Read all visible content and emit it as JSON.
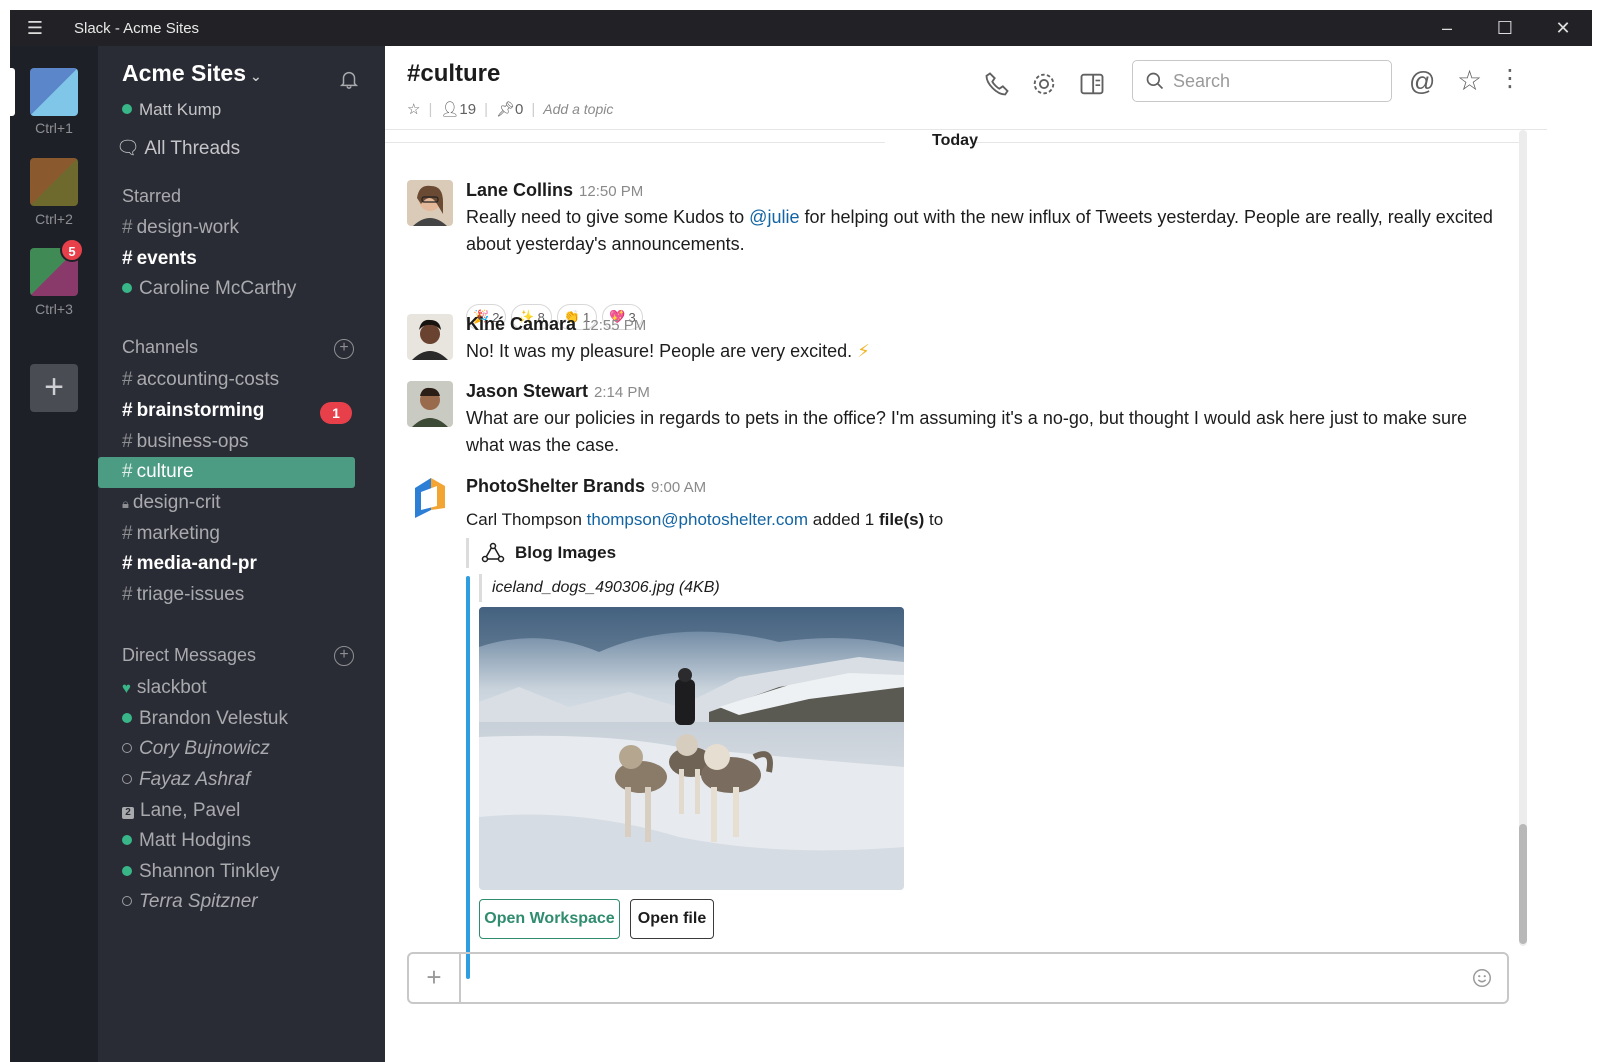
{
  "window": {
    "title": "Slack - Acme Sites"
  },
  "workspaces": [
    {
      "shortcut": "Ctrl+1",
      "colors": [
        "#5b86c9",
        "#7fc6e8"
      ]
    },
    {
      "shortcut": "Ctrl+2",
      "colors": [
        "#8a5a2e",
        "#6e6a2e"
      ]
    },
    {
      "shortcut": "Ctrl+3",
      "colors": [
        "#3f8a55",
        "#8a3a6a"
      ],
      "badge": "5"
    }
  ],
  "sidebar": {
    "team_name": "Acme Sites",
    "user_name": "Matt Kump",
    "all_threads": "All Threads",
    "starred_heading": "Starred",
    "starred": [
      {
        "label": "design-work",
        "type": "channel"
      },
      {
        "label": "events",
        "type": "channel",
        "bold": true
      },
      {
        "label": "Caroline McCarthy",
        "type": "dm-online"
      }
    ],
    "channels_heading": "Channels",
    "channels": [
      {
        "label": "accounting-costs"
      },
      {
        "label": "brainstorming",
        "bold": true,
        "badge": "1"
      },
      {
        "label": "business-ops"
      },
      {
        "label": "culture",
        "active": true
      },
      {
        "label": "design-crit",
        "private": true
      },
      {
        "label": "marketing"
      },
      {
        "label": "media-and-pr",
        "bold": true
      },
      {
        "label": "triage-issues"
      }
    ],
    "dm_heading": "Direct Messages",
    "dms": [
      {
        "label": "slackbot",
        "status": "heart"
      },
      {
        "label": "Brandon Velestuk",
        "status": "online"
      },
      {
        "label": "Cory Bujnowicz",
        "status": "away"
      },
      {
        "label": "Fayaz Ashraf",
        "status": "away"
      },
      {
        "label": "Lane, Pavel",
        "status": "group",
        "group_count": "2"
      },
      {
        "label": "Matt Hodgins",
        "status": "online"
      },
      {
        "label": "Shannon Tinkley",
        "status": "online"
      },
      {
        "label": "Terra Spitzner",
        "status": "away"
      }
    ]
  },
  "channel": {
    "name": "#culture",
    "members": "19",
    "pins": "0",
    "topic_placeholder": "Add a topic"
  },
  "search": {
    "placeholder": "Search"
  },
  "messages": {
    "day_divider": "Today",
    "m1": {
      "author": "Lane Collins",
      "time": "12:50 PM",
      "text_before": "Really need to give some Kudos to ",
      "mention": "@julie",
      "text_after": " for helping out with the new influx of Tweets yesterday. People are really, really excited about yesterday's announcements.",
      "reactions": [
        {
          "emoji": "🎉",
          "count": "2"
        },
        {
          "emoji": "✨",
          "count": "8"
        },
        {
          "emoji": "👏",
          "count": "1"
        },
        {
          "emoji": "💖",
          "count": "3"
        }
      ]
    },
    "m2": {
      "author": "Kiné Camara",
      "time": "12:55 PM",
      "text": "No! It was my pleasure! People are very excited.",
      "emoji": "⚡"
    },
    "m3": {
      "author": "Jason Stewart",
      "time": "2:14 PM",
      "text": "What are our policies in regards to pets in the office? I'm assuming it's a no-go, but thought I would ask here just to make sure what was the case."
    },
    "m4": {
      "author": "PhotoShelter Brands",
      "time": "9:00 AM",
      "actor": "Carl Thompson",
      "email": "thompson@photoshelter.com",
      "added_before": "added 1",
      "added_bold": "file(s)",
      "added_after": "to",
      "attachment_title": "Blog Images",
      "file_name": "iceland_dogs_490306.jpg (4KB)",
      "button_workspace": "Open Workspace",
      "button_file": "Open file"
    }
  },
  "colors": {
    "titlebar": "#222226",
    "workspace_bar": "#1e2028",
    "sidebar": "#2a2c35",
    "active_channel": "#4c9b83",
    "badge": "#e8404a",
    "link": "#1264a3",
    "attachment_bar": "#2d9ee0",
    "button_green": "#2f8c6e"
  }
}
